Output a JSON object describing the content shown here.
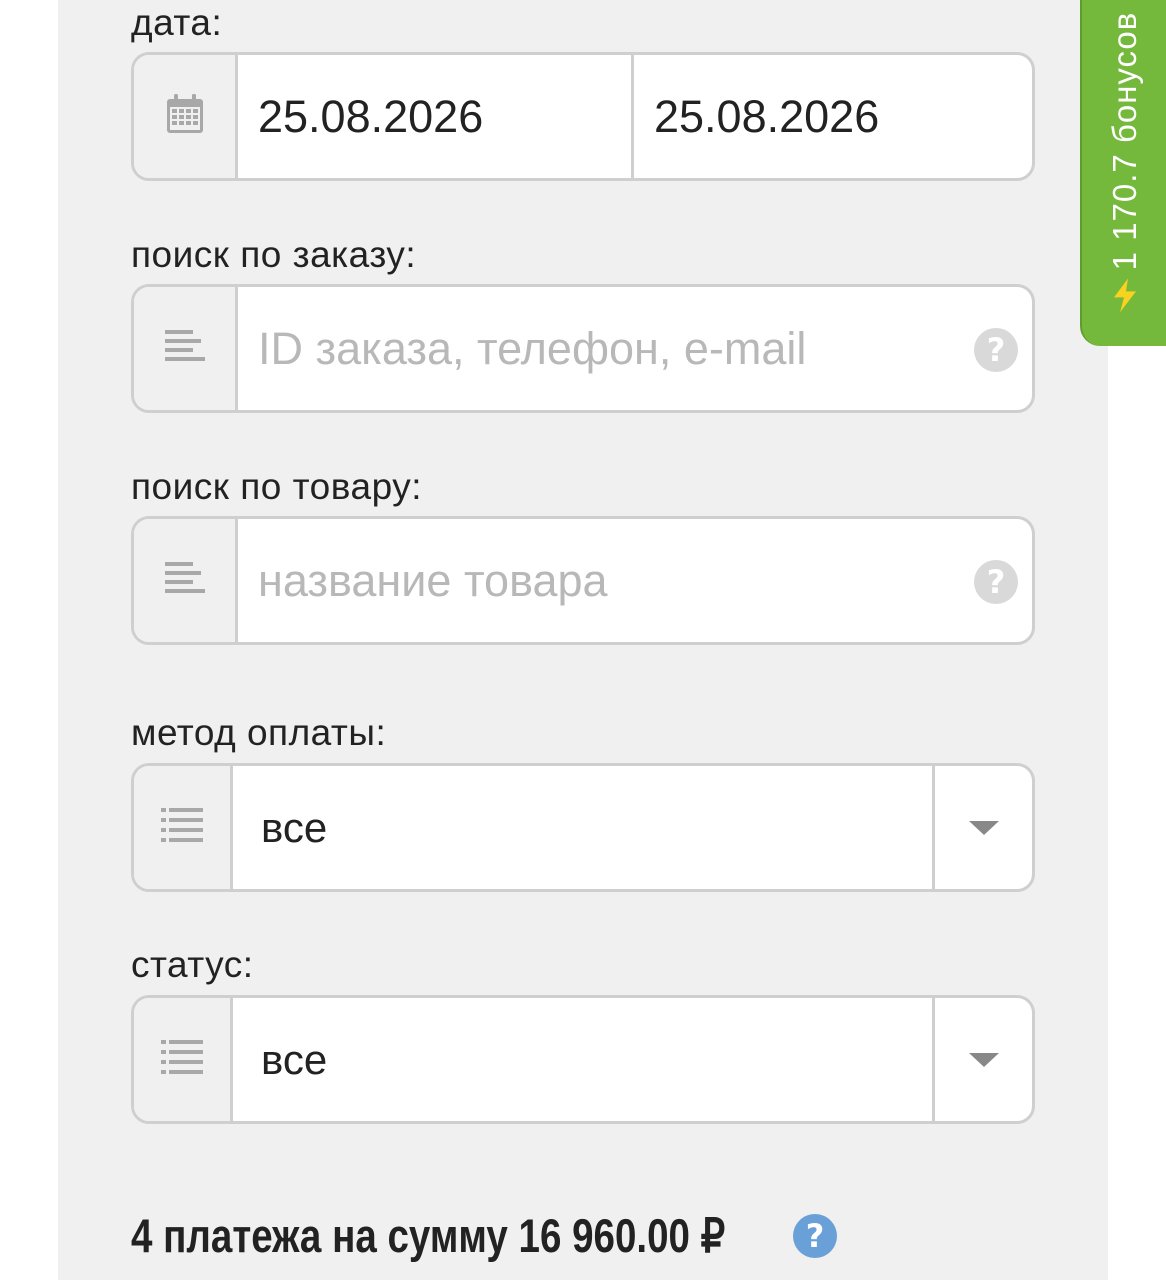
{
  "filters": {
    "date": {
      "label": "дата:",
      "from": "25.08.2026",
      "to": "25.08.2026"
    },
    "order_search": {
      "label": "поиск по заказу:",
      "placeholder": "ID заказа, телефон, e-mail"
    },
    "product_search": {
      "label": "поиск по товару:",
      "placeholder": "название товара"
    },
    "payment_method": {
      "label": "метод оплаты:",
      "selected": "все"
    },
    "status": {
      "label": "статус:",
      "selected": "все"
    }
  },
  "summary": {
    "text": "4 платежа на сумму 16 960.00 ₽"
  },
  "bonus_tab": {
    "text": "1 170.7 бонусов"
  },
  "help_glyph": "?",
  "colors": {
    "bonus_green": "#74b83c",
    "summary_help_blue": "#6aa0d8",
    "field_border": "#cfcfcf",
    "panel_bg": "#f0f0f0"
  },
  "icons": {
    "date": "calendar-icon",
    "order_search": "align-left-icon",
    "product_search": "align-left-icon",
    "payment_method": "list-icon",
    "status": "list-icon",
    "bonus": "lightning-icon"
  }
}
